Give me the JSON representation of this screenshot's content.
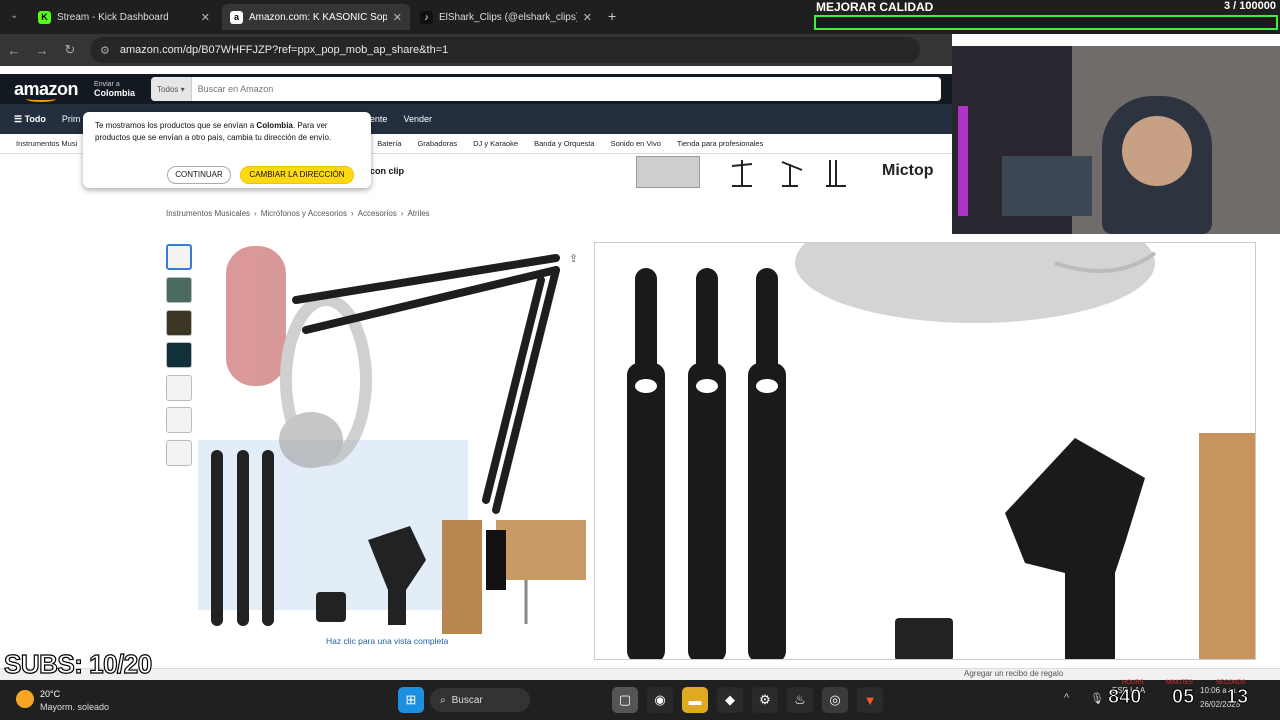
{
  "browser": {
    "tabs": [
      {
        "label": "Stream - Kick Dashboard",
        "icon": "K",
        "icon_color": "#53fc18",
        "active": false
      },
      {
        "label": "Amazon.com: K KASONIC Sop",
        "icon": "a",
        "icon_color": "#ffffff",
        "active": true
      },
      {
        "label": "ElShark_Clips (@elshark_clips)",
        "icon": "♪",
        "icon_color": "#111111",
        "active": false
      }
    ],
    "url": "amazon.com/dp/B07WHFFJZP?ref=ppx_pop_mob_ap_share&th=1"
  },
  "amazon": {
    "logo": "amazon",
    "deliver_line1": "Enviar a",
    "deliver_line2": "Colombia",
    "search_category": "Todos",
    "search_placeholder": "Buscar en Amazon",
    "nav": [
      "Todo",
      "Prim",
      "rvicio al Cliente",
      "Vender"
    ],
    "categories": [
      "Instrumentos Musi",
      "Batería",
      "Grabadoras",
      "DJ y Karaoke",
      "Banda y Orquesta",
      "Sonido en Vivo",
      "Tienda para profesionales"
    ],
    "banner_text": "con clip",
    "banner_brand": "Mictop",
    "breadcrumb": [
      "Instrumentos Musicales",
      "Micrófonos y Accesorios",
      "Accesorios",
      "Atriles"
    ],
    "full_view_link": "Haz clic para una vista completa",
    "popup": {
      "text_before": "Te mostramos los productos que se envían a ",
      "text_bold": "Colombia",
      "text_after": ". Para ver productos que se envían a otro país, cambia tu dirección de envío.",
      "continue_label": "CONTINUAR",
      "change_label": "CAMBIAR LA DIRECCIÓN"
    },
    "gift_text": "Agregar un recibo de regalo"
  },
  "overlays": {
    "quality_label": "MEJORAR CALIDAD",
    "quality_count": "3 / 100000",
    "quality_progress": 3e-05,
    "subs": "SUBS: 10/20",
    "timer_labels": [
      "HOURS",
      "MINUTES",
      "SECONDS"
    ],
    "timer_values": [
      "840",
      "05",
      "13"
    ]
  },
  "taskbar": {
    "weather_temp": "20°C",
    "weather_desc": "Mayorm. soleado",
    "search_label": "Buscar",
    "clock_time": "10:06 a.m.",
    "clock_date": "26/02/2025",
    "lang": "ESP LAA"
  }
}
